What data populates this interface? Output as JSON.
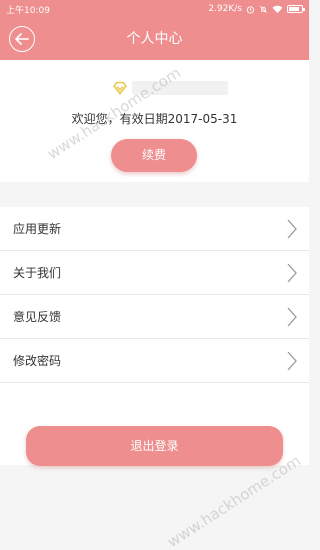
{
  "status_bar": {
    "time": "上午10:09",
    "net_speed": "2.92K/s",
    "icons": [
      "alarm-icon",
      "mute-icon",
      "wifi-icon",
      "battery-icon"
    ]
  },
  "nav": {
    "title": "个人中心",
    "back_icon": "back-arrow-icon"
  },
  "profile": {
    "vip_icon": "vip-badge-icon",
    "welcome_text": "欢迎您，有效日期2017-05-31",
    "renew_label": "续费"
  },
  "menu": {
    "items": [
      {
        "label": "应用更新"
      },
      {
        "label": "关于我们"
      },
      {
        "label": "意见反馈"
      },
      {
        "label": "修改密码"
      }
    ]
  },
  "logout_label": "退出登录",
  "watermark_text": "www.hackhome.com",
  "colors": {
    "accent": "#ee8e8e",
    "background": "#f5f5f5",
    "card": "#ffffff"
  }
}
